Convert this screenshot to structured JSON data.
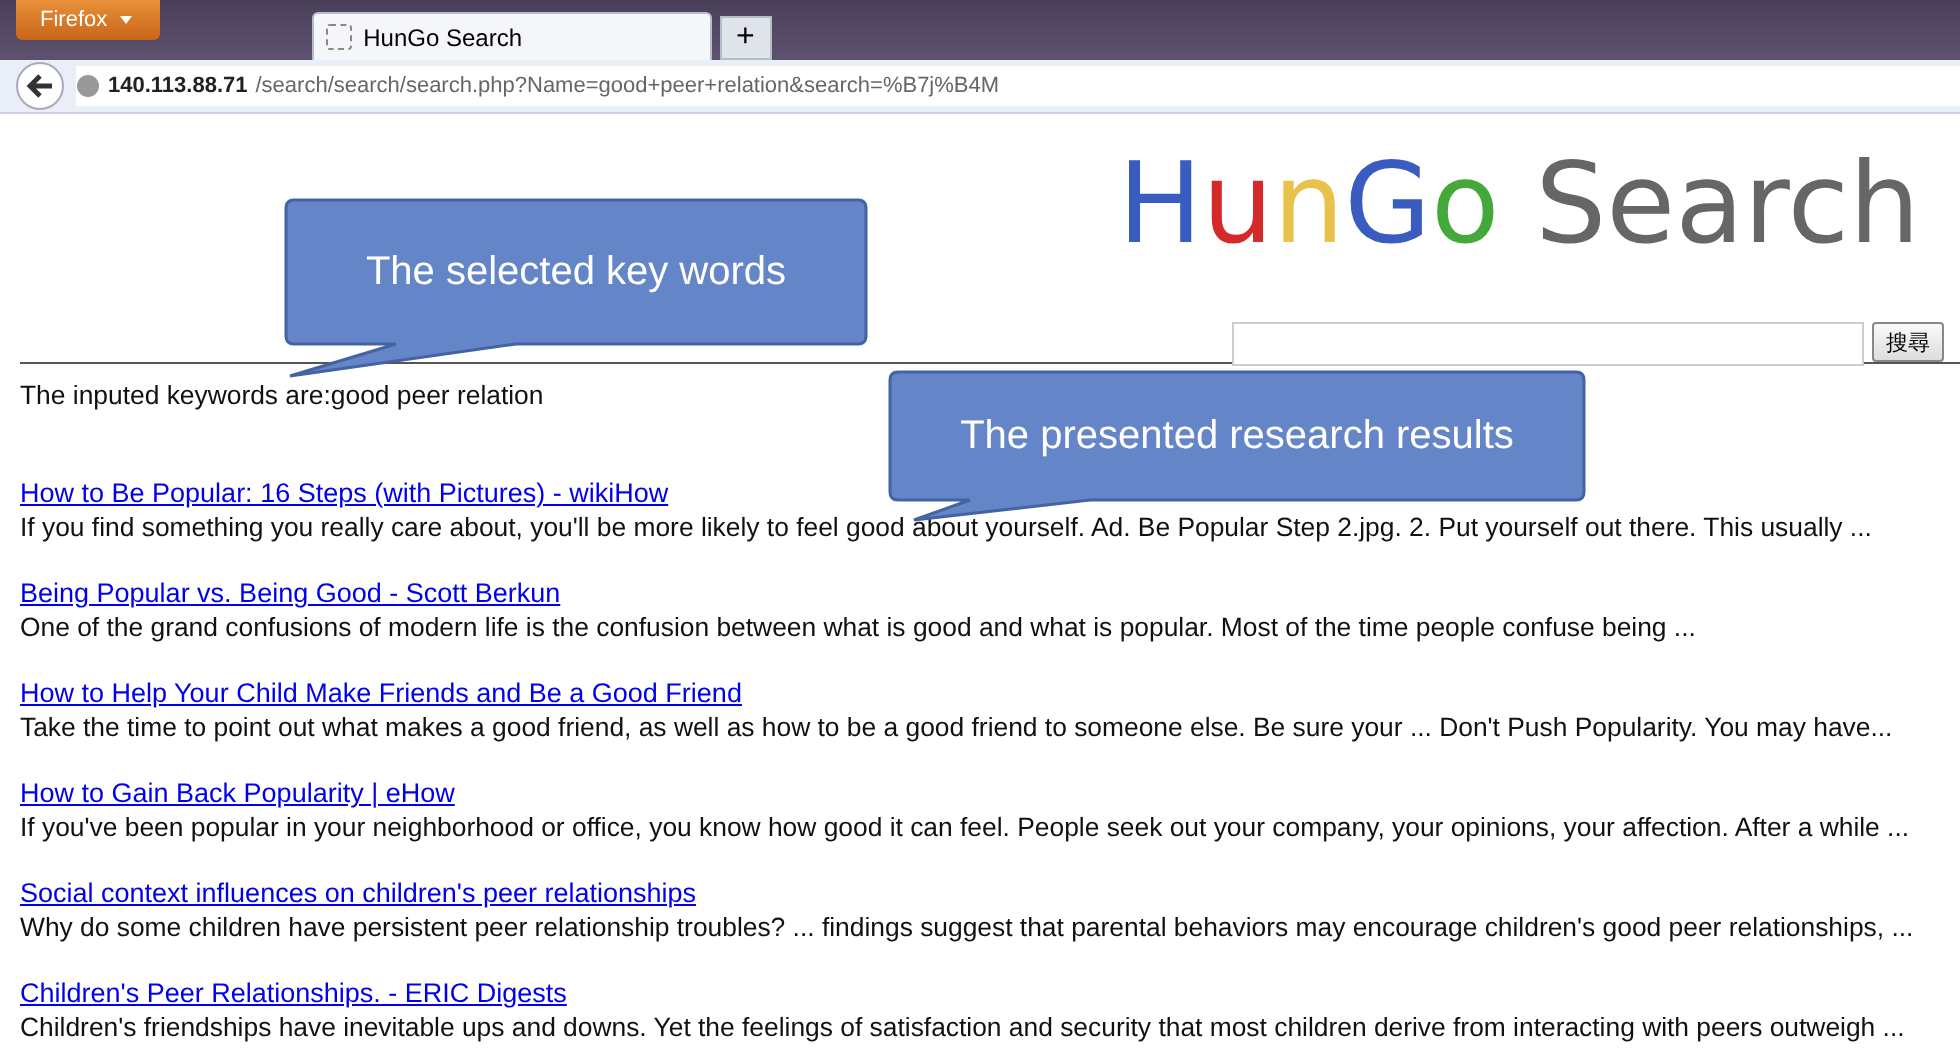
{
  "browser": {
    "menu_button": "Firefox",
    "tabs": [
      {
        "label": "HunGo Search",
        "selected": true
      }
    ],
    "new_tab": "+",
    "url_host": "140.113.88.71",
    "url_path": "/search/search/search.php?Name=good+peer+relation&search=%B7j%B4M"
  },
  "logo": [
    {
      "text": "H",
      "color": "#3a5bbf"
    },
    {
      "text": "u",
      "color": "#d42a2a"
    },
    {
      "text": "n",
      "color": "#e8c24a"
    },
    {
      "text": "G",
      "color": "#3a5bbf"
    },
    {
      "text": "o",
      "color": "#45a83a"
    },
    {
      "text": " Search",
      "color": "#666666"
    }
  ],
  "search": {
    "button": "搜尋"
  },
  "keywords_line": "The inputed keywords are:good peer relation",
  "results": [
    {
      "title": "How to Be Popular: 16 Steps (with Pictures) - wikiHow",
      "snippet": "If you find something you really care about, you'll be more likely to feel good about yourself. Ad. Be Popular Step 2.jpg. 2. Put yourself out there. This usually ..."
    },
    {
      "title": "Being Popular vs. Being Good - Scott Berkun",
      "snippet": "One of the grand confusions of modern life is the confusion between what is good and what is popular. Most of the time people confuse being ..."
    },
    {
      "title": "How to Help Your Child Make Friends and Be a Good Friend",
      "snippet": "Take the time to point out what makes a good friend, as well as how to be a good friend to someone else. Be sure your ... Don't Push Popularity. You may have..."
    },
    {
      "title": "How to Gain Back Popularity | eHow",
      "snippet": "If you've been popular in your neighborhood or office, you know how good it can feel. People seek out your company, your opinions, your affection. After a while ..."
    },
    {
      "title": "Social context influences on children's peer relationships",
      "snippet": "Why do some children have persistent peer relationship troubles? ... findings suggest that parental behaviors may encourage children's good peer relationships, ..."
    },
    {
      "title": "Children's Peer Relationships. - ERIC Digests",
      "snippet": "Children's friendships have inevitable ups and downs. Yet the feelings of satisfaction and security that most children derive from interacting with peers outweigh ..."
    }
  ],
  "callouts": [
    {
      "text": "The selected key words"
    },
    {
      "text": "The presented research results"
    }
  ]
}
